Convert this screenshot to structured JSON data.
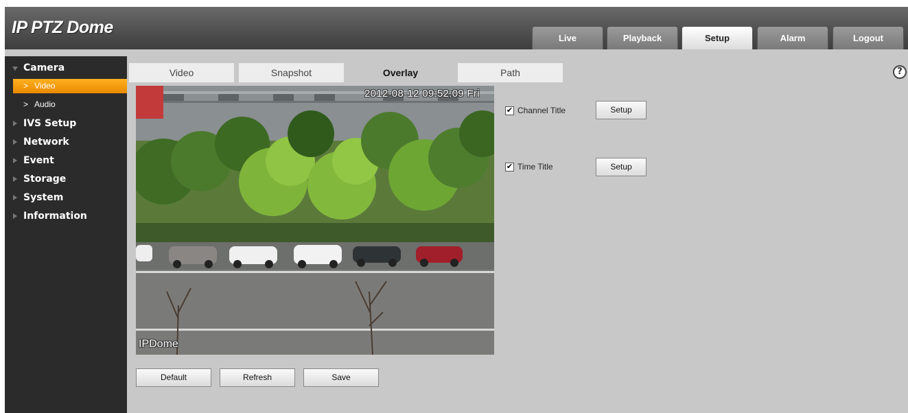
{
  "app": {
    "title": "IP PTZ Dome"
  },
  "nav": [
    {
      "label": "Live",
      "active": false
    },
    {
      "label": "Playback",
      "active": false
    },
    {
      "label": "Setup",
      "active": true
    },
    {
      "label": "Alarm",
      "active": false
    },
    {
      "label": "Logout",
      "active": false
    }
  ],
  "sidebar": {
    "camera": "Camera",
    "video": "Video",
    "audio": "Audio",
    "ivs": "IVS Setup",
    "network": "Network",
    "event": "Event",
    "storage": "Storage",
    "system": "System",
    "information": "Information"
  },
  "tabs": [
    {
      "label": "Video",
      "active": false
    },
    {
      "label": "Snapshot",
      "active": false
    },
    {
      "label": "Overlay",
      "active": true
    },
    {
      "label": "Path",
      "active": false
    }
  ],
  "video": {
    "time_overlay": "2012-08-12 09:52:09 Fri",
    "channel_overlay": "IPDome"
  },
  "options": {
    "channel_title": {
      "label": "Channel Title",
      "checked": true,
      "button": "Setup"
    },
    "time_title": {
      "label": "Time Title",
      "checked": true,
      "button": "Setup"
    }
  },
  "buttons": {
    "default": "Default",
    "refresh": "Refresh",
    "save": "Save"
  },
  "icons": {
    "help": "?",
    "check": "✔",
    "chevron": ">"
  },
  "colors": {
    "active_sidebar": "#f29a0c",
    "header": "#4e4e4e",
    "sidebar": "#2b2b2b"
  }
}
